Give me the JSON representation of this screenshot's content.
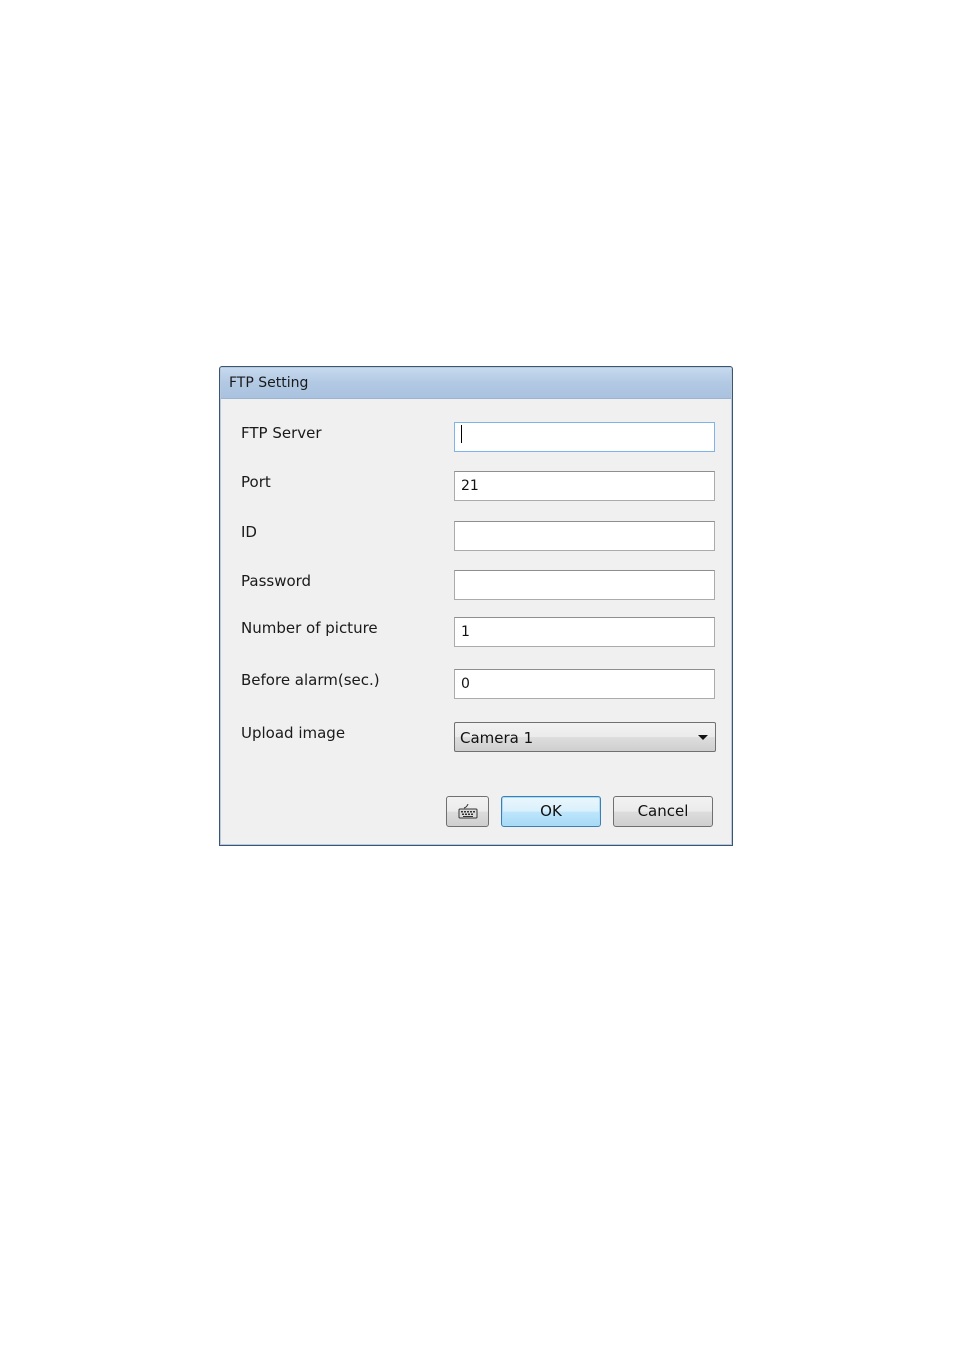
{
  "dialog": {
    "title": "FTP Setting",
    "fields": {
      "ftp_server": {
        "label": "FTP Server",
        "value": ""
      },
      "port": {
        "label": "Port",
        "value": "21"
      },
      "id": {
        "label": "ID",
        "value": ""
      },
      "password": {
        "label": "Password",
        "value": ""
      },
      "number_of_picture": {
        "label": "Number of picture",
        "value": "1"
      },
      "before_alarm": {
        "label": "Before alarm(sec.)",
        "value": "0"
      },
      "upload_image": {
        "label": "Upload image",
        "value": "Camera 1"
      }
    },
    "buttons": {
      "keyboard_icon": "keyboard-icon",
      "ok": "OK",
      "cancel": "Cancel"
    }
  }
}
